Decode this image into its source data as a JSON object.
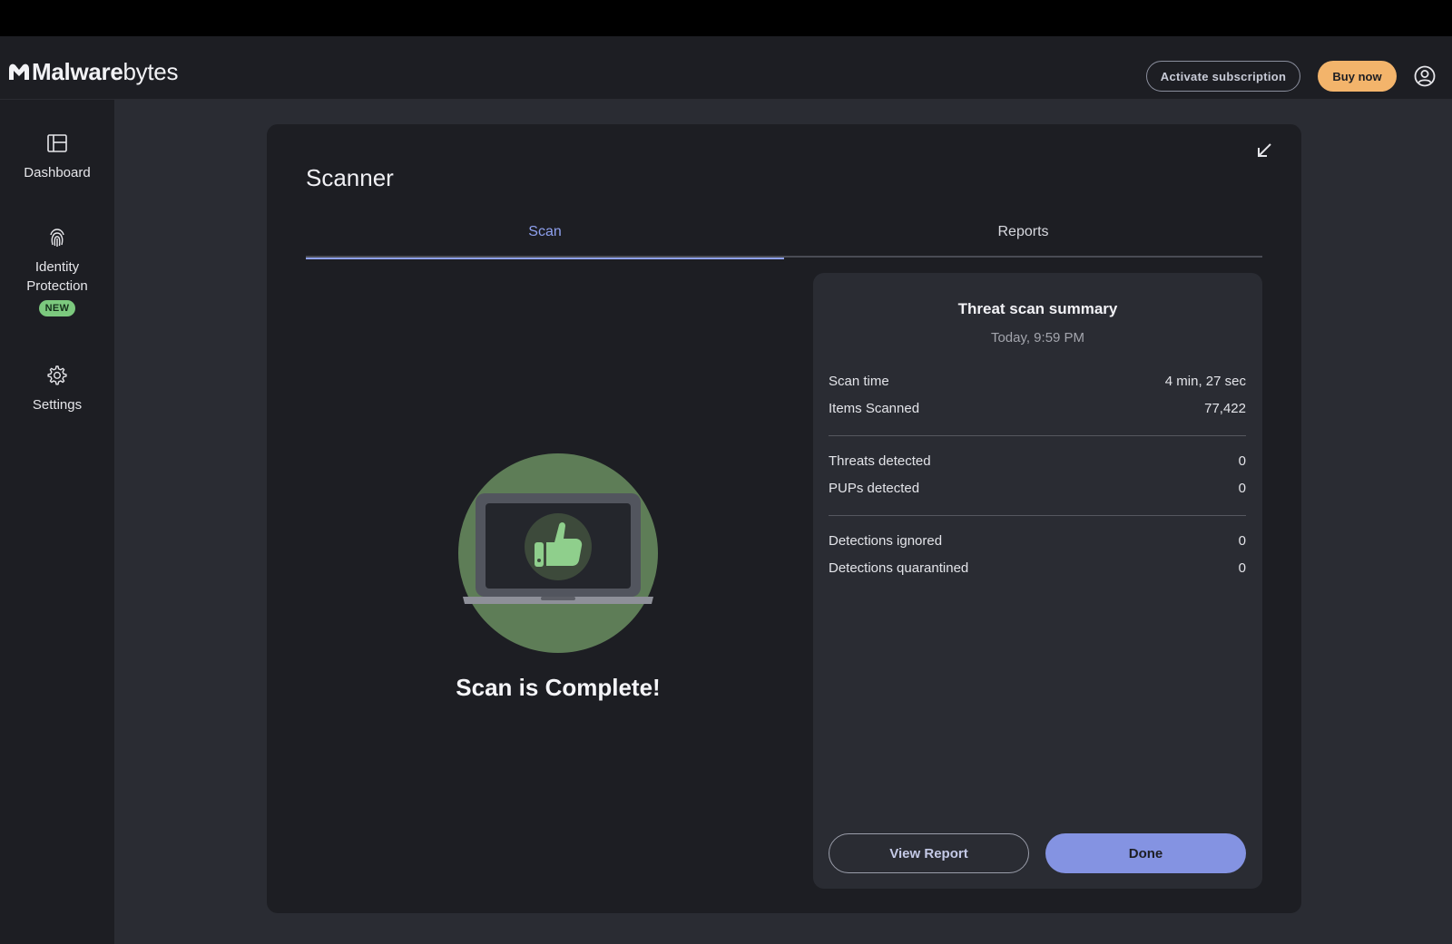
{
  "app": {
    "brand_bold": "Malware",
    "brand_light": "bytes"
  },
  "header": {
    "activate_label": "Activate subscription",
    "buy_label": "Buy now"
  },
  "sidebar": {
    "items": [
      {
        "label": "Dashboard",
        "icon": "dashboard-icon"
      },
      {
        "label": "Identity Protection",
        "icon": "fingerprint-icon",
        "badge": "NEW"
      },
      {
        "label": "Settings",
        "icon": "gear-icon"
      }
    ]
  },
  "scanner": {
    "title": "Scanner",
    "tabs": [
      {
        "label": "Scan",
        "active": true
      },
      {
        "label": "Reports",
        "active": false
      }
    ],
    "status_text": "Scan is Complete!"
  },
  "summary": {
    "title": "Threat scan summary",
    "date": "Today, 9:59 PM",
    "rows": [
      {
        "label": "Scan time",
        "value": "4 min, 27 sec"
      },
      {
        "label": "Items Scanned",
        "value": "77,422"
      },
      {
        "label": "Threats detected",
        "value": "0"
      },
      {
        "label": "PUPs detected",
        "value": "0"
      },
      {
        "label": "Detections ignored",
        "value": "0"
      },
      {
        "label": "Detections quarantined",
        "value": "0"
      }
    ],
    "view_report_label": "View Report",
    "done_label": "Done"
  },
  "colors": {
    "accent": "#8493e2",
    "buy": "#f3b46b",
    "badge": "#7cc97e",
    "illustration_circle": "#5e7d57"
  }
}
